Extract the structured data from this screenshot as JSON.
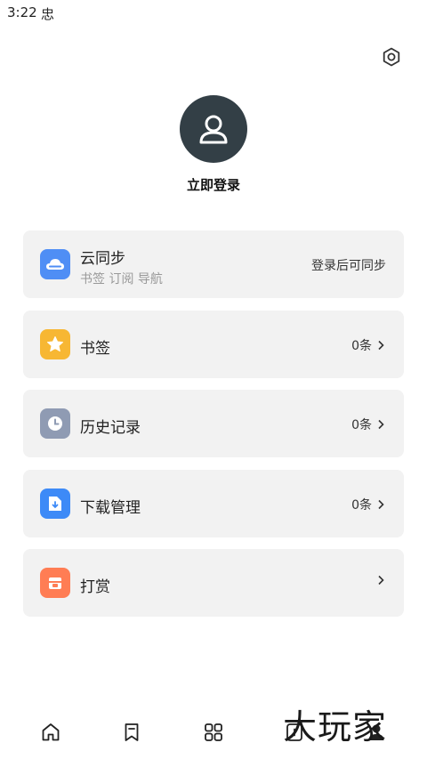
{
  "status_bar": {
    "time": "3:22",
    "indicator": "忠"
  },
  "header": {
    "settings_icon": "settings-gear-icon"
  },
  "profile": {
    "login_label": "立即登录",
    "avatar_icon": "user-icon"
  },
  "colors": {
    "cloud": "#4f8ef5",
    "bookmark": "#f7b733",
    "history": "#8f9bb3",
    "download": "#3d8af7",
    "reward": "#ff7d54"
  },
  "menu": {
    "cloud_sync": {
      "title": "云同步",
      "subtitle": "书签 订阅 导航",
      "status": "登录后可同步",
      "icon": "cloud-icon"
    },
    "bookmarks": {
      "title": "书签",
      "count": "0条",
      "icon": "star-icon"
    },
    "history": {
      "title": "历史记录",
      "count": "0条",
      "icon": "clock-icon"
    },
    "downloads": {
      "title": "下载管理",
      "count": "0条",
      "icon": "download-file-icon"
    },
    "reward": {
      "title": "打赏",
      "icon": "gift-icon"
    }
  },
  "bottom_nav": {
    "items": [
      "home-icon",
      "bookmark-icon",
      "apps-grid-icon",
      "tabs-icon",
      "profile-icon"
    ]
  },
  "watermark": {
    "text": "大玩家"
  }
}
